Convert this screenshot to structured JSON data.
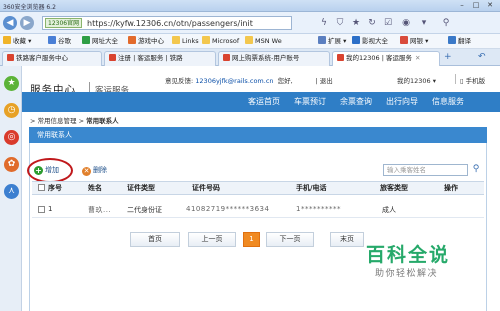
{
  "browser": {
    "title": "360安全浏览器 6.2",
    "badge": "12306官网",
    "url": "https://kyfw.12306.cn/otn/passengers/init",
    "favorites": [
      {
        "label": "收藏",
        "color": "#f0b429"
      },
      {
        "label": "谷歌",
        "color": "#4a7fd6"
      },
      {
        "label": "网址大全",
        "color": "#2e9e45"
      },
      {
        "label": "游戏中心",
        "color": "#e26a2c"
      },
      {
        "label": "Links",
        "color": "#f3c74d"
      },
      {
        "label": "Microsof",
        "color": "#f3c74d"
      },
      {
        "label": "MSN We",
        "color": "#f3c74d"
      }
    ],
    "favorites_right": [
      {
        "label": "扩展",
        "color": "#5b7fc0"
      },
      {
        "label": "影视大全",
        "color": "#2b6fc8"
      },
      {
        "label": "网银",
        "color": "#d94b3c"
      },
      {
        "label": "翻译",
        "color": "#3a79c8"
      }
    ],
    "tabs": [
      {
        "label": "铁路客户服务中心"
      },
      {
        "label": "注册 | 客运服务 | 铁路"
      },
      {
        "label": "网上购票系统-用户账号"
      },
      {
        "label": "我的12306 | 客运服务"
      }
    ]
  },
  "site": {
    "logo_main": "服务中心",
    "logo_sub": "客运服务",
    "feedback_label": "意见反馈:",
    "feedback_email": "12306yjfk@rails.com.cn",
    "greeting": "您好,",
    "logout": "退出",
    "my_account": "我的12306 ▾",
    "mobile": "手机版",
    "nav": [
      "客运首页",
      "车票预订",
      "余票查询",
      "出行向导",
      "信息服务"
    ]
  },
  "breadcrumb": {
    "prefix": "> 常用信息管理  >",
    "current": "常用联系人"
  },
  "panel": {
    "title": "常用联系人",
    "add": "增加",
    "delete": "删除",
    "search_placeholder": "输入乘客姓名",
    "columns": [
      "序号",
      "姓名",
      "证件类型",
      "证件号码",
      "手机/电话",
      "旅客类型",
      "操作"
    ],
    "rows": [
      {
        "index": "1",
        "name": "曹玖...",
        "id_type": "二代身份证",
        "id_number": "41082719******3634",
        "phone": "1**********",
        "passenger_type": "成人"
      }
    ]
  },
  "pager": {
    "first": "首页",
    "prev": "上一页",
    "current": "1",
    "next": "下一页",
    "last": "末页"
  },
  "watermark": {
    "main": "百科全说",
    "sub": "助你轻松解决"
  }
}
